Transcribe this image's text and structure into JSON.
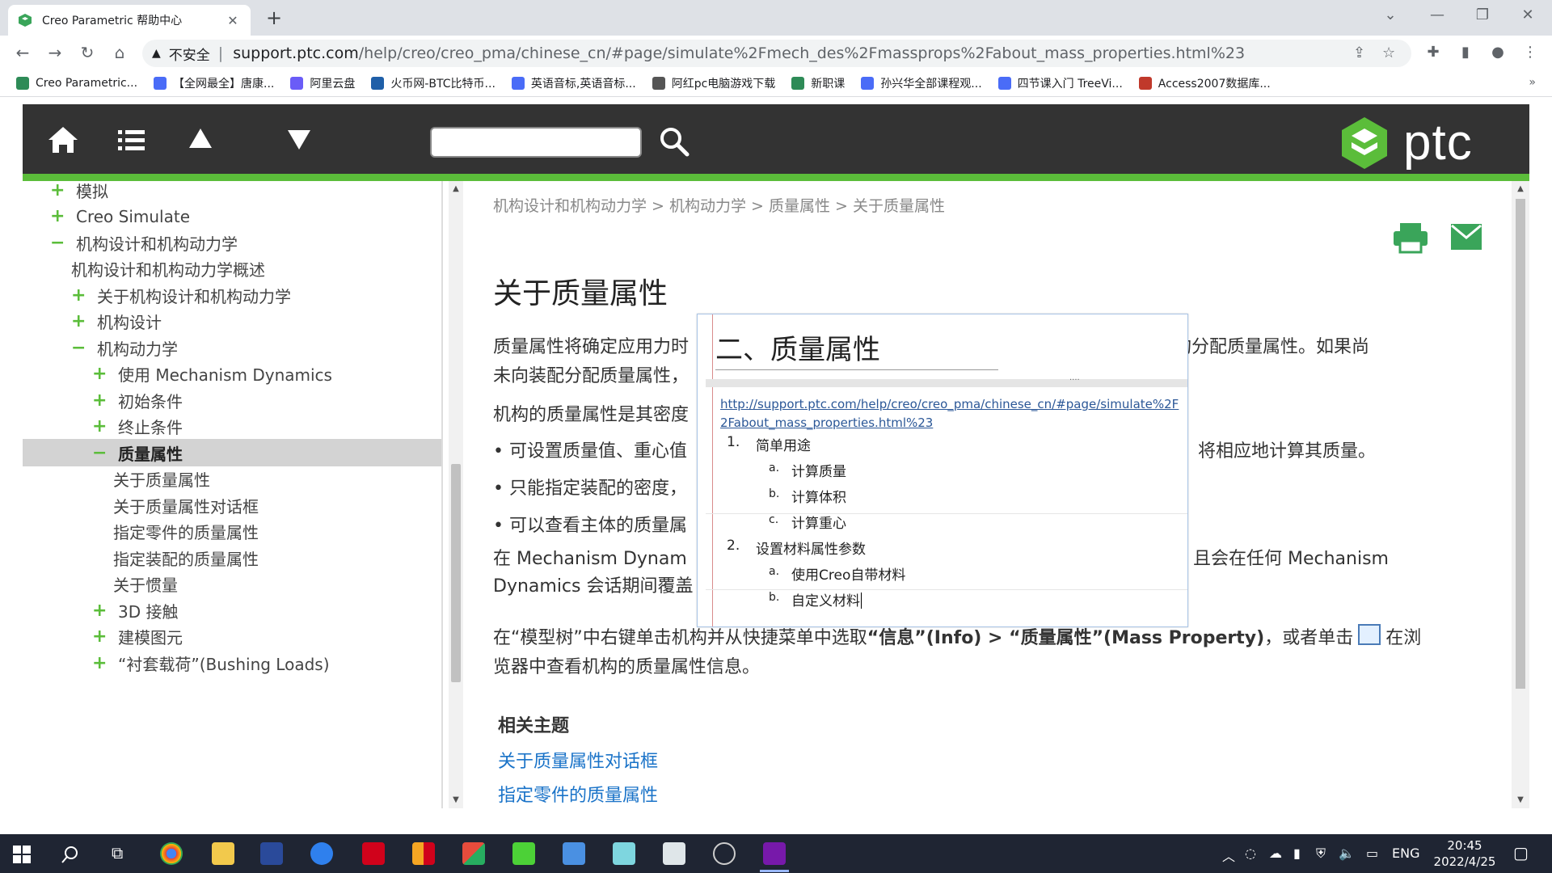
{
  "browser": {
    "tab_title": "Creo Parametric 帮助中心",
    "insecure_label": "不安全",
    "url_host": "support.ptc.com",
    "url_path": "/help/creo/creo_pma/chinese_cn/#page/simulate%2Fmech_des%2Fmassprops%2Fabout_mass_properties.html%23",
    "bookmarks": [
      {
        "label": "Creo Parametric...",
        "color": "#2e8b57"
      },
      {
        "label": "【全网最全】唐康...",
        "color": "#4a6cf7"
      },
      {
        "label": "阿里云盘",
        "color": "#6a5cf7"
      },
      {
        "label": "火币网-BTC比特币...",
        "color": "#1f5fa8"
      },
      {
        "label": "英语音标,英语音标...",
        "color": "#4a6cf7"
      },
      {
        "label": "阿红pc电脑游戏下载",
        "color": "#555555"
      },
      {
        "label": "新职课",
        "color": "#2e8b57"
      },
      {
        "label": "孙兴华全部课程观...",
        "color": "#4a6cf7"
      },
      {
        "label": "四节课入门 TreeVi...",
        "color": "#4a6cf7"
      },
      {
        "label": "Access2007数据库...",
        "color": "#c0392b"
      }
    ],
    "bookmarks_more": "»"
  },
  "header": {
    "logo_text": "ptc",
    "search_placeholder": ""
  },
  "toc": {
    "items": [
      {
        "label": "模拟",
        "sign": "+",
        "indent": 0
      },
      {
        "label": "Creo Simulate",
        "sign": "+",
        "indent": 0
      },
      {
        "label": "机构设计和机构动力学",
        "sign": "−",
        "indent": 0
      },
      {
        "label": "机构设计和机构动力学概述",
        "sign": "",
        "indent": 1
      },
      {
        "label": "关于机构设计和机构动力学",
        "sign": "+",
        "indent": 1
      },
      {
        "label": "机构设计",
        "sign": "+",
        "indent": 1
      },
      {
        "label": "机构动力学",
        "sign": "−",
        "indent": 1
      },
      {
        "label": "使用 Mechanism Dynamics",
        "sign": "+",
        "indent": 2
      },
      {
        "label": "初始条件",
        "sign": "+",
        "indent": 2
      },
      {
        "label": "终止条件",
        "sign": "+",
        "indent": 2
      },
      {
        "label": "质量属性",
        "sign": "−",
        "indent": 2,
        "selected": true
      },
      {
        "label": "关于质量属性",
        "sign": "",
        "indent": 3
      },
      {
        "label": "关于质量属性对话框",
        "sign": "",
        "indent": 3
      },
      {
        "label": "指定零件的质量属性",
        "sign": "",
        "indent": 3
      },
      {
        "label": "指定装配的质量属性",
        "sign": "",
        "indent": 3
      },
      {
        "label": "关于惯量",
        "sign": "",
        "indent": 3
      },
      {
        "label": "3D 接触",
        "sign": "+",
        "indent": 2
      },
      {
        "label": "建模图元",
        "sign": "+",
        "indent": 2
      },
      {
        "label": "“衬套载荷”(Bushing Loads)",
        "sign": "+",
        "indent": 2
      }
    ]
  },
  "content": {
    "breadcrumb": "机构设计和机构动力学 > 机构动力学 > 质量属性 > 关于质量属性",
    "title": "关于质量属性",
    "p1_a": "质量属性将确定应用力时",
    "p1_b": "行，必须为机构分配质量属性。如果尚",
    "p1_c": "未向装配分配质量属性，",
    "p2": "机构的质量属性是其密度",
    "bullets_a": [
      "• 可设置质量值、重心值",
      "• 只能指定装配的密度，",
      "• 可以查看主体的质量属"
    ],
    "bullet1_tail": "将相应地计算其质量。",
    "p3_a": "在 Mechanism Dynam",
    "p3_b": "中有效，且会在任何 Mechanism",
    "p3_c": "Dynamics 会话期间覆盖",
    "p4_pre": "在“模型树”中右键单击机构并从快捷菜单中选取",
    "p4_bold": "“信息”(Info) > “质量属性”(Mass Property)",
    "p4_mid": "，或者单击",
    "p4_post": "在浏",
    "p4_line2": "览器中查看机构的质量属性信息。",
    "related_heading": "相关主题",
    "related_links": [
      "关于质量属性对话框",
      "指定零件的质量属性"
    ]
  },
  "note": {
    "title": "二、质量属性",
    "link_line1": "http://support.ptc.com/help/creo/creo_pma/chinese_cn/#page/simulate%2F",
    "link_line2": "2Fabout_mass_properties.html%23",
    "items": [
      {
        "num": "1.",
        "label": "简单用途",
        "subs": [
          {
            "letter": "a.",
            "label": "计算质量"
          },
          {
            "letter": "b.",
            "label": "计算体积"
          },
          {
            "letter": "c.",
            "label": "计算重心"
          }
        ]
      },
      {
        "num": "2.",
        "label": "设置材料属性参数",
        "subs": [
          {
            "letter": "a.",
            "label": "使用Creo自带材料"
          },
          {
            "letter": "b.",
            "label": "自定义材料"
          }
        ]
      }
    ]
  },
  "taskbar": {
    "lang": "ENG",
    "time": "20:45",
    "date": "2022/4/25"
  },
  "colors": {
    "ptc_green": "#5bbd3a",
    "header_bg": "#333333",
    "link": "#1a73c8"
  }
}
